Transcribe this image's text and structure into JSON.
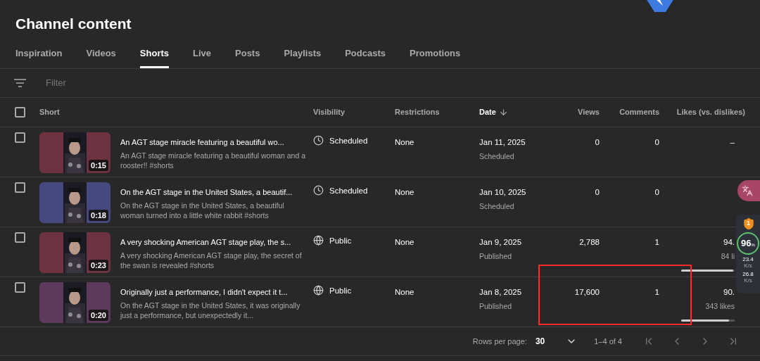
{
  "page": {
    "title": "Channel content"
  },
  "tabs": [
    {
      "label": "Inspiration",
      "selected": false
    },
    {
      "label": "Videos",
      "selected": false
    },
    {
      "label": "Shorts",
      "selected": true
    },
    {
      "label": "Live",
      "selected": false
    },
    {
      "label": "Posts",
      "selected": false
    },
    {
      "label": "Playlists",
      "selected": false
    },
    {
      "label": "Podcasts",
      "selected": false
    },
    {
      "label": "Promotions",
      "selected": false
    }
  ],
  "filter": {
    "placeholder": "Filter"
  },
  "table": {
    "select_all": {
      "checked": false
    },
    "columns": [
      {
        "label": "Short",
        "sorted": false
      },
      {
        "label": "Visibility",
        "sorted": false
      },
      {
        "label": "Restrictions",
        "sorted": false
      },
      {
        "label": "Date",
        "sorted": true
      },
      {
        "label": "Views",
        "sorted": false
      },
      {
        "label": "Comments",
        "sorted": false
      },
      {
        "label": "Likes (vs. dislikes)",
        "sorted": false
      }
    ],
    "rows": [
      {
        "checked": false,
        "duration": "0:15",
        "title": "An AGT stage miracle featuring a beautiful wo...",
        "description": "An AGT stage miracle featuring a beautiful woman and a rooster!! #shorts",
        "visibility": {
          "kind": "scheduled",
          "label": "Scheduled"
        },
        "restrictions": "None",
        "date": "Jan 11, 2025",
        "date_status": "Scheduled",
        "views": "0",
        "comments": "0",
        "likes": {
          "value": "–"
        }
      },
      {
        "checked": false,
        "duration": "0:18",
        "title": "On the AGT stage in the United States, a beautif...",
        "description": "On the AGT stage in the United States, a beautiful woman turned into a little white rabbit #shorts",
        "visibility": {
          "kind": "scheduled",
          "label": "Scheduled"
        },
        "restrictions": "None",
        "date": "Jan 10, 2025",
        "date_status": "Scheduled",
        "views": "0",
        "comments": "0",
        "likes": {}
      },
      {
        "checked": false,
        "duration": "0:23",
        "title": "A very shocking American AGT stage play, the s...",
        "description": "A very shocking American AGT stage play, the secret of the swan is revealed #shorts",
        "visibility": {
          "kind": "public",
          "label": "Public"
        },
        "restrictions": "None",
        "date": "Jan 9, 2025",
        "date_status": "Published",
        "views": "2,788",
        "comments": "1",
        "likes": {
          "value": "94.",
          "count": "84 li",
          "level": 0.97
        }
      },
      {
        "checked": false,
        "duration": "0:20",
        "title": "Originally just a performance, I didn't expect it t...",
        "description": "On the AGT stage in the United States, it was originally just a performance, but unexpectedly it...",
        "visibility": {
          "kind": "public",
          "label": "Public"
        },
        "restrictions": "None",
        "date": "Jan 8, 2025",
        "date_status": "Published",
        "views": "17,600",
        "comments": "1",
        "likes": {
          "value": "90.",
          "count": "343 likes",
          "level": 0.9
        }
      }
    ]
  },
  "pagination": {
    "rows_per_page_label": "Rows per page:",
    "rows_per_page": "30",
    "range": "1–4 of 4"
  },
  "overlay_widget": {
    "shield_count": "1",
    "score": "96",
    "score_unit": "%",
    "upload": "23.4",
    "upload_unit": "K/s",
    "download": "26.8",
    "download_unit": "K/s"
  }
}
